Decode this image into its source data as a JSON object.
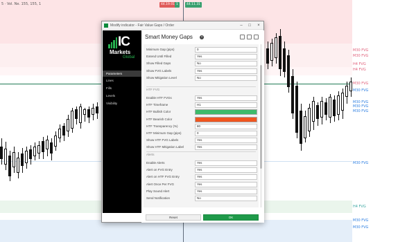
{
  "chart": {
    "symbol_info": "5 · Vol. Ne. 155, 155, 1",
    "top_chips": [
      "44.19.01",
      "1",
      "44.11.31"
    ],
    "zone_labels": [
      {
        "text": "M30 FVG",
        "color": "#e0607a"
      },
      {
        "text": "M30 FVG",
        "color": "#e0607a"
      },
      {
        "text": "H4 FVG",
        "color": "#e0607a"
      },
      {
        "text": "H4 FVG",
        "color": "#e0607a"
      },
      {
        "text": "M30 FVG",
        "color": "#e0607a"
      },
      {
        "text": "M30 FVG",
        "color": "#2a7de1"
      },
      {
        "text": "M30 FVG",
        "color": "#2a7de1"
      },
      {
        "text": "M30 FVG",
        "color": "#2a7de1"
      },
      {
        "text": "M30 FVG",
        "color": "#2a7de1"
      },
      {
        "text": "M30 FVG",
        "color": "#2a7de1"
      },
      {
        "text": "H4 FVG",
        "color": "#3aa6a0"
      },
      {
        "text": "M30 FVG",
        "color": "#2a7de1"
      },
      {
        "text": "M30 FVG",
        "color": "#2a7de1"
      }
    ],
    "colors": {
      "bearish_zone": "#fde4e6",
      "bullish_zone": "#e4eef9",
      "neutral_zone": "#eaf5ec",
      "up_candle": "#ffffff",
      "down_candle": "#111111",
      "accent_green": "#27b14f"
    }
  },
  "dialog": {
    "window_title": "Modify indicator - Fair Value Gaps / Order",
    "brand": {
      "ic": "IC",
      "markets": "Markets",
      "global": "Global"
    },
    "nav": [
      {
        "label": "Parameters",
        "active": true
      },
      {
        "label": "Lines",
        "active": false
      },
      {
        "label": "Fills",
        "active": false
      },
      {
        "label": "Levels",
        "active": false
      },
      {
        "label": "Visibility",
        "active": false
      }
    ],
    "content_title": "Smart Money Gaps",
    "help_icon": "?",
    "group1": [
      {
        "label": "Minimum Gap (pips)",
        "value": "0"
      },
      {
        "label": "Extend Until Filled",
        "value": "Yes"
      },
      {
        "label": "Show Filled Gaps",
        "value": "No"
      },
      {
        "label": "Show FVG Labels",
        "value": "Yes"
      },
      {
        "label": "Show Mitigation Level",
        "value": "No"
      }
    ],
    "group2_header": "HTF FVG",
    "group2": [
      {
        "label": "Enable HTF FVGs",
        "value": "Yes"
      },
      {
        "label": "HTF Timeframe",
        "value": "H1"
      },
      {
        "label": "HTF Bullish Color",
        "value": "",
        "swatch": "#3dbb6a"
      },
      {
        "label": "HTF Bearish Color",
        "value": "",
        "swatch": "#f0551f"
      },
      {
        "label": "HTF Transparency (%)",
        "value": "80"
      },
      {
        "label": "HTF Minimum Gap (pips)",
        "value": "0"
      },
      {
        "label": "Show HTF FVG Labels",
        "value": "Yes"
      },
      {
        "label": "Show HTF Mitigation Label",
        "value": "Yes"
      }
    ],
    "group3_header": "Alerts",
    "group3": [
      {
        "label": "Enable Alerts",
        "value": "Yes"
      },
      {
        "label": "Alert on FVG Entry",
        "value": "Yes"
      },
      {
        "label": "Alert on HTF FVG Entry",
        "value": "Yes"
      },
      {
        "label": "Alert Once Per FVG",
        "value": "Yes"
      },
      {
        "label": "Play Sound Alert",
        "value": "Yes"
      },
      {
        "label": "Send Notification",
        "value": "No"
      }
    ],
    "reset_label": "Reset",
    "ok_label": "OK"
  }
}
